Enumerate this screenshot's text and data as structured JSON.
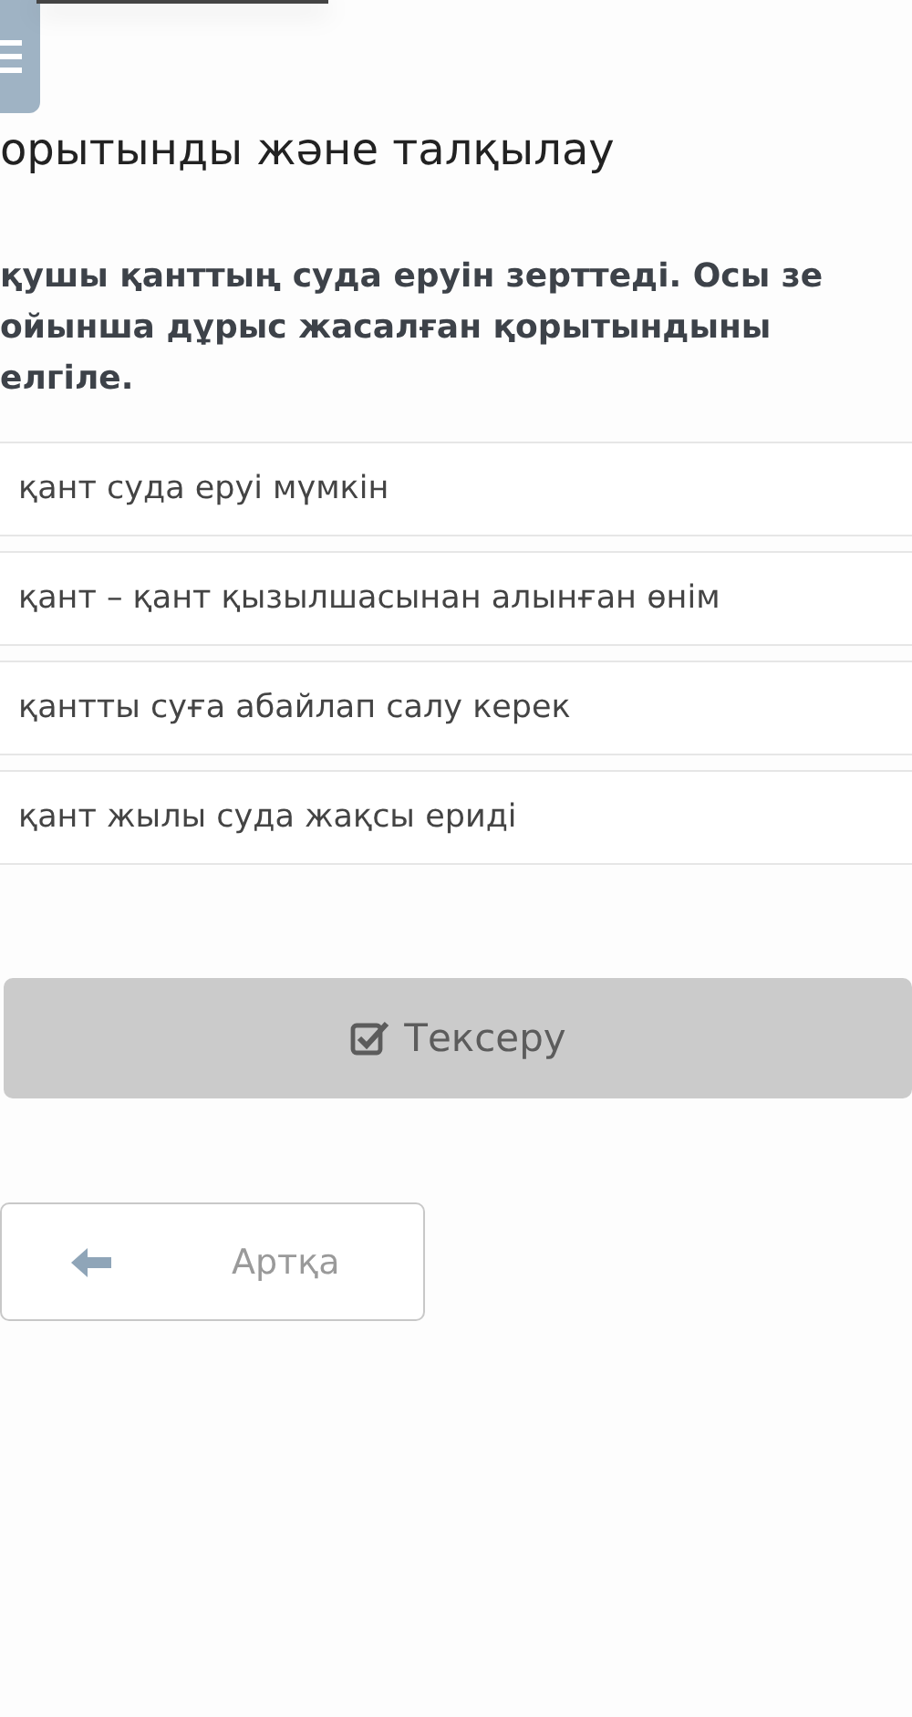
{
  "title": "орытынды және талқылау",
  "question": [
    "қушы қанттың суда еруін зерттеді. Осы зе",
    "ойынша дұрыс жасалған қорытындыны",
    "елгіле."
  ],
  "options": [
    {
      "label": "қант суда еруі мүмкін",
      "selected": false
    },
    {
      "label": "қант – қант қызылшасынан алынған өнім",
      "selected": false
    },
    {
      "label": "қантты суға абайлап салу керек",
      "selected": false
    },
    {
      "label": "қант жылы суда жақсы ериді",
      "selected": false
    }
  ],
  "check_button": {
    "label": "Тексеру",
    "disabled": true
  },
  "back_button": {
    "label": "Артқа"
  }
}
